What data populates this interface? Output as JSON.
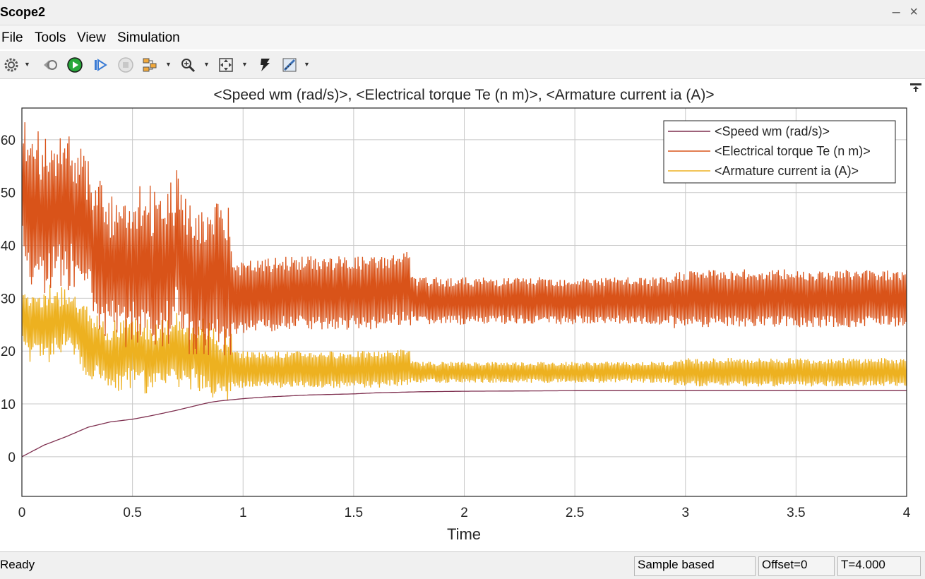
{
  "window": {
    "title": "Scope2",
    "minimize": "–",
    "close": "×"
  },
  "menu": [
    "File",
    "Tools",
    "View",
    "Simulation"
  ],
  "toolbar": {
    "icons": [
      "gear-icon",
      "step-back-icon",
      "run-icon",
      "step-forward-icon",
      "stop-icon",
      "signal-config-icon",
      "zoom-icon",
      "autoscale-icon",
      "highlight-block-icon",
      "measurement-icon"
    ]
  },
  "colors": {
    "speed": "#7e2f4f",
    "torque": "#d95319",
    "current": "#edb120",
    "grid": "#c8c8c8"
  },
  "chart_data": {
    "type": "line",
    "title": "<Speed wm (rad/s)>, <Electrical torque Te (n m)>, <Armature current ia (A)>",
    "xlabel": "Time",
    "ylabel": "",
    "xlim": [
      0,
      4
    ],
    "ylim": [
      -7.5,
      66
    ],
    "xticks": [
      0,
      0.5,
      1,
      1.5,
      2,
      2.5,
      3,
      3.5,
      4
    ],
    "xtick_labels": [
      "0",
      "0.5",
      "1",
      "1.5",
      "2",
      "2.5",
      "3",
      "3.5",
      "4"
    ],
    "yticks": [
      0,
      10,
      20,
      30,
      40,
      50,
      60
    ],
    "ytick_labels": [
      "0",
      "10",
      "20",
      "30",
      "40",
      "50",
      "60"
    ],
    "grid": true,
    "legend_position": "top-right",
    "series": [
      {
        "name": "<Speed wm (rad/s)>",
        "color": "#7e2f4f",
        "x": [
          0,
          0.1,
          0.2,
          0.3,
          0.4,
          0.5,
          0.6,
          0.7,
          0.8,
          0.85,
          0.9,
          1.0,
          1.1,
          1.2,
          1.3,
          1.4,
          1.5,
          1.6,
          1.7,
          1.8,
          2.0,
          2.5,
          3.0,
          3.5,
          4.0
        ],
        "y": [
          0,
          2.2,
          3.8,
          5.6,
          6.6,
          7.1,
          7.9,
          8.8,
          9.8,
          10.3,
          10.6,
          11.0,
          11.3,
          11.5,
          11.7,
          11.8,
          11.9,
          12.1,
          12.2,
          12.3,
          12.4,
          12.5,
          12.5,
          12.5,
          12.5
        ]
      },
      {
        "name": "<Electrical torque Te (n m)>",
        "color": "#d95319",
        "x": [
          0,
          0.1,
          0.2,
          0.3,
          0.4,
          0.5,
          0.6,
          0.7,
          0.75,
          0.8,
          0.9,
          0.95,
          1.0,
          1.2,
          1.4,
          1.6,
          1.75,
          1.77,
          1.8,
          2.0,
          2.5,
          2.95,
          3.0,
          3.5,
          4.0
        ],
        "y": [
          50,
          45,
          48,
          42,
          35,
          37,
          35,
          38,
          35,
          32,
          35,
          30,
          30,
          31,
          31,
          31,
          32,
          29.5,
          29.5,
          29.5,
          29.5,
          29.5,
          30,
          30,
          30
        ]
      },
      {
        "name": "<Armature current ia (A)>",
        "color": "#edb120",
        "x": [
          0,
          0.1,
          0.2,
          0.3,
          0.4,
          0.5,
          0.6,
          0.7,
          0.8,
          0.9,
          1.0,
          1.2,
          1.4,
          1.6,
          1.75,
          1.77,
          1.8,
          2.0,
          2.5,
          2.95,
          3.0,
          3.5,
          4.0
        ],
        "y": [
          26,
          25,
          26,
          22,
          18,
          20,
          19,
          20,
          19,
          17,
          16.5,
          16.5,
          16.5,
          16.5,
          17,
          16,
          16,
          16,
          16,
          16,
          16,
          16,
          16
        ]
      }
    ]
  },
  "status": {
    "text": "Ready",
    "mode": "Sample based",
    "offset": "Offset=0",
    "time": "T=4.000"
  }
}
